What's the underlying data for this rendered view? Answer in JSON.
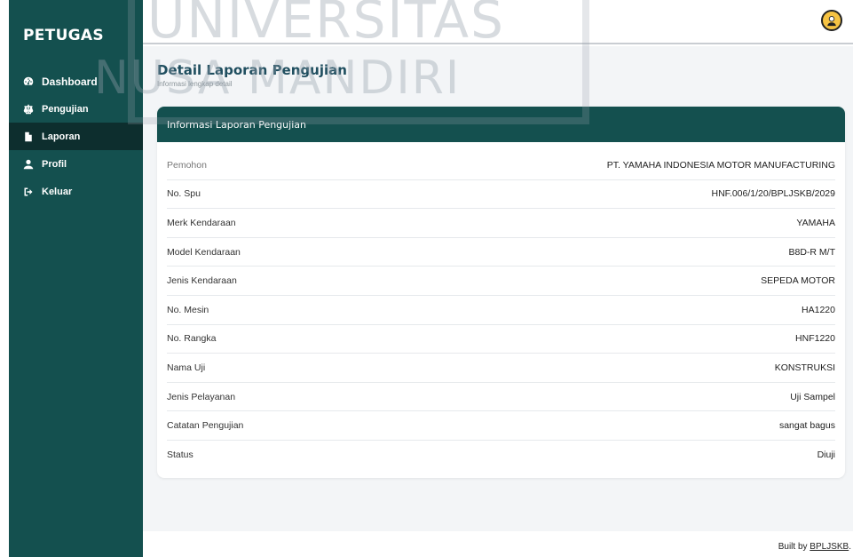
{
  "sidebar": {
    "brand": "PETUGAS",
    "items": [
      {
        "label": "Dashboard",
        "icon": "tachometer-icon",
        "active": false
      },
      {
        "label": "Pengujian",
        "icon": "balance-scale-icon",
        "active": false
      },
      {
        "label": "Laporan",
        "icon": "file-icon",
        "active": true
      },
      {
        "label": "Profil",
        "icon": "user-icon",
        "active": false
      },
      {
        "label": "Keluar",
        "icon": "sign-out-icon",
        "active": false
      }
    ]
  },
  "topbar": {
    "avatar_icon": "user-avatar-icon"
  },
  "page": {
    "title": "Detail Laporan Pengujian",
    "subtitle": "Informasi lengkap detail"
  },
  "card": {
    "header": "Informasi Laporan Pengujian",
    "rows": [
      {
        "label": "Pemohon",
        "value": "PT. YAMAHA INDONESIA MOTOR MANUFACTURING"
      },
      {
        "label": "No. Spu",
        "value": "HNF.006/1/20/BPLJSKB/2029"
      },
      {
        "label": "Merk Kendaraan",
        "value": "YAMAHA"
      },
      {
        "label": "Model Kendaraan",
        "value": "B8D-R M/T"
      },
      {
        "label": "Jenis Kendaraan",
        "value": "SEPEDA MOTOR"
      },
      {
        "label": "No. Mesin",
        "value": "HA1220"
      },
      {
        "label": "No. Rangka",
        "value": "HNF1220"
      },
      {
        "label": "Nama Uji",
        "value": "KONSTRUKSI"
      },
      {
        "label": "Jenis Pelayanan",
        "value": "Uji Sampel"
      },
      {
        "label": "Catatan Pengujian",
        "value": "sangat bagus"
      },
      {
        "label": "Status",
        "value": "Diuji"
      }
    ]
  },
  "footer": {
    "prefix": "Built by ",
    "link": "BPLJSKB",
    "suffix": "."
  },
  "watermark": {
    "line1": "UNIVERSITAS",
    "line2": "NUSA MANDIRI"
  },
  "colors": {
    "sidebar": "#14504f",
    "active": "#0d2e2e",
    "header": "#14504f",
    "background": "#f3f5f7"
  }
}
